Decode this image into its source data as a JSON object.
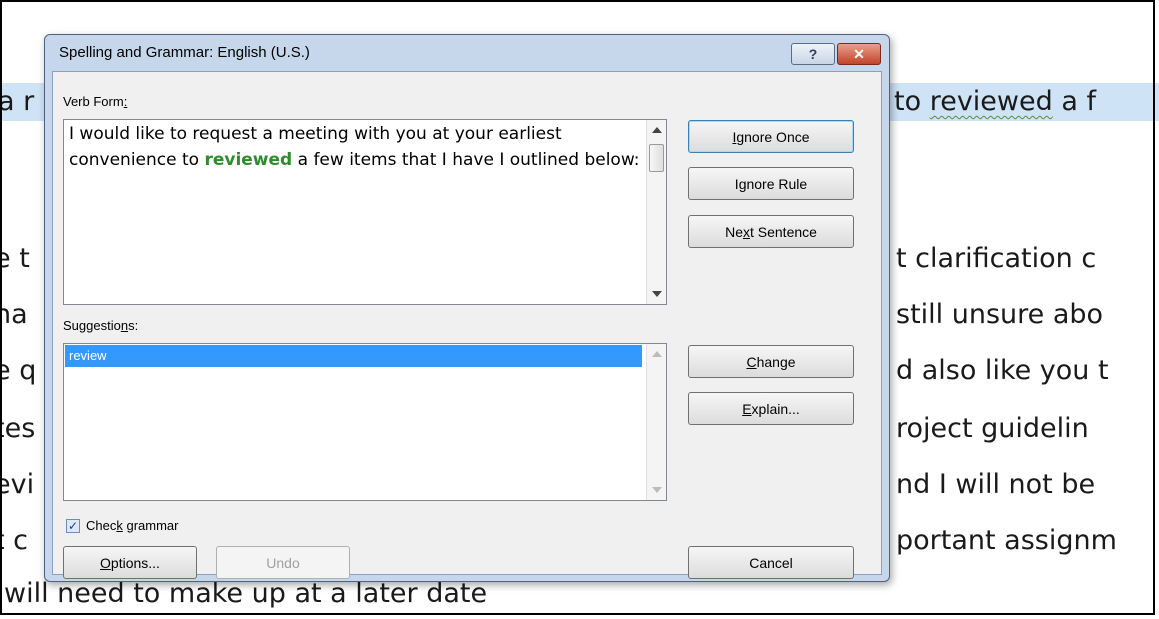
{
  "document": {
    "line1_left": "a r",
    "line1_right_pre": "to ",
    "line1_right_err": "reviewed",
    "line1_right_post": " a f",
    "lines_left": [
      "e t",
      "ha",
      "e q",
      "tes",
      "evi",
      "t c"
    ],
    "lines_right": [
      "t clarification c",
      "still unsure abo",
      "d also like you t",
      "roject guidelin",
      "nd I will not be",
      "portant assignm"
    ],
    "last_line": "will need to make up at a later date"
  },
  "dialog": {
    "title": "Spelling and Grammar: English (U.S.)",
    "help_icon_glyph": "?",
    "close_icon_glyph": "✕",
    "error_label": "Verb Form",
    "error_label_suffix": ":",
    "sentence_pre": "I would like to request a meeting with you at your earliest convenience to ",
    "sentence_error": "reviewed",
    "sentence_post": " a few items that I have I outlined below:",
    "suggestions_label_pre": "Suggestio",
    "suggestions_label_acc": "n",
    "suggestions_label_post": "s:",
    "suggestions": [
      "review"
    ],
    "checkbox_checked": true,
    "check_grammar_pre": "Chec",
    "check_grammar_acc": "k",
    "check_grammar_post": " grammar",
    "buttons": {
      "ignore_once_acc": "I",
      "ignore_once_rest": "gnore Once",
      "ignore_rule_pre": "I",
      "ignore_rule_acc": "g",
      "ignore_rule_rest": "nore Rule",
      "next_sentence_pre": "Ne",
      "next_sentence_acc": "x",
      "next_sentence_rest": "t Sentence",
      "change_acc": "C",
      "change_rest": "hange",
      "explain_acc": "E",
      "explain_rest": "xplain...",
      "options_acc": "O",
      "options_rest": "ptions...",
      "undo": "Undo",
      "cancel": "Cancel"
    }
  },
  "colors": {
    "selection": "#3399ff",
    "error_text": "#2e8b2e",
    "highlight": "#cfe3f6"
  }
}
